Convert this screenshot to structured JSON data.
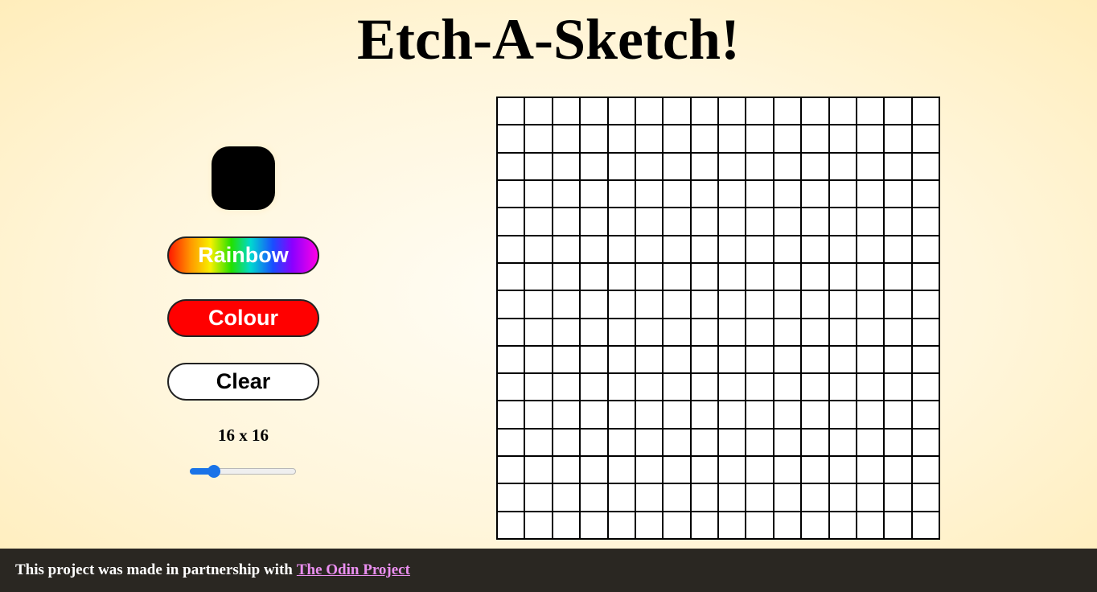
{
  "header": {
    "title": "Etch-A-Sketch!"
  },
  "controls": {
    "current_color": "#000000",
    "rainbow_label": "Rainbow",
    "colour_label": "Colour",
    "clear_label": "Clear",
    "size_label": "16 x 16",
    "slider": {
      "value_fraction": 0.23
    }
  },
  "grid": {
    "rows": 16,
    "cols": 16,
    "cell_color": "#ffffff",
    "line_color": "#000000"
  },
  "footer": {
    "text": "This project was made in partnership with",
    "link_text": "The Odin Project",
    "link_color": "#ea8ff0"
  }
}
